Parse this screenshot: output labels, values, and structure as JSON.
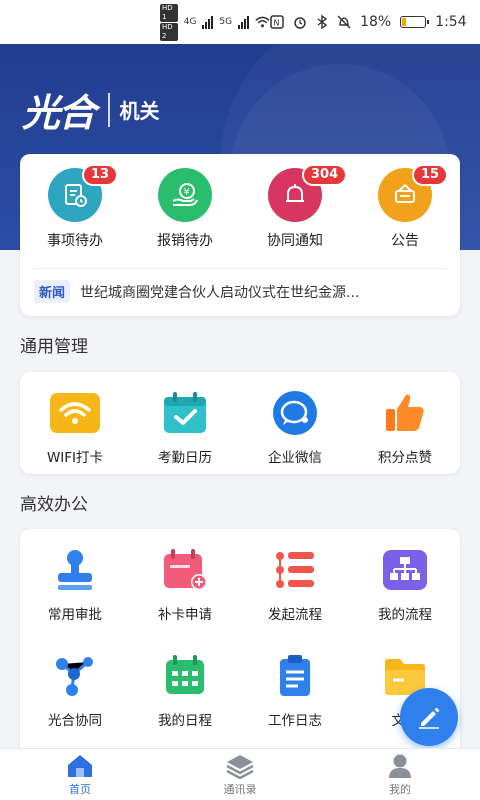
{
  "status_bar": {
    "hd1": "HD 1",
    "hd2": "HD 2",
    "net1": "4G",
    "net2": "5G",
    "battery_percent": "18%",
    "time": "1:54"
  },
  "header": {
    "logo_text": "光合",
    "org_label": "机关"
  },
  "quick_actions": [
    {
      "label": "事项待办",
      "badge": "13",
      "color": "#2fa6c0",
      "icon": "todo-icon"
    },
    {
      "label": "报销待办",
      "badge": "",
      "color": "#2bbd6e",
      "icon": "reimburse-icon"
    },
    {
      "label": "协同通知",
      "badge": "304",
      "color": "#d73660",
      "icon": "bell-icon"
    },
    {
      "label": "公告",
      "badge": "15",
      "color": "#f2a11c",
      "icon": "announcement-icon"
    }
  ],
  "news": {
    "tag": "新闻",
    "headline": "世纪城商圈党建合伙人启动仪式在世纪金源..."
  },
  "general_section": {
    "title": "通用管理",
    "items": [
      {
        "label": "WIFI打卡",
        "icon": "wifi-icon"
      },
      {
        "label": "考勤日历",
        "icon": "attendance-calendar-icon"
      },
      {
        "label": "企业微信",
        "icon": "wecom-icon"
      },
      {
        "label": "积分点赞",
        "icon": "thumbs-up-icon"
      }
    ]
  },
  "office_section": {
    "title": "高效办公",
    "items": [
      {
        "label": "常用审批",
        "icon": "stamp-icon"
      },
      {
        "label": "补卡申请",
        "icon": "calendar-add-icon"
      },
      {
        "label": "发起流程",
        "icon": "list-icon"
      },
      {
        "label": "我的流程",
        "icon": "org-chart-icon"
      },
      {
        "label": "光合协同",
        "icon": "network-icon"
      },
      {
        "label": "我的日程",
        "icon": "schedule-icon"
      },
      {
        "label": "工作日志",
        "icon": "clipboard-icon"
      },
      {
        "label": "文档",
        "icon": "folder-icon"
      }
    ]
  },
  "tabbar": {
    "items": [
      {
        "label": "首页",
        "icon": "home-icon",
        "active": true
      },
      {
        "label": "通讯录",
        "icon": "layers-icon",
        "active": false
      },
      {
        "label": "我的",
        "icon": "user-icon",
        "active": false
      }
    ]
  },
  "colors": {
    "primary": "#2f6fe0",
    "hero_bg": "#223d8f",
    "badge": "#e6373a"
  }
}
